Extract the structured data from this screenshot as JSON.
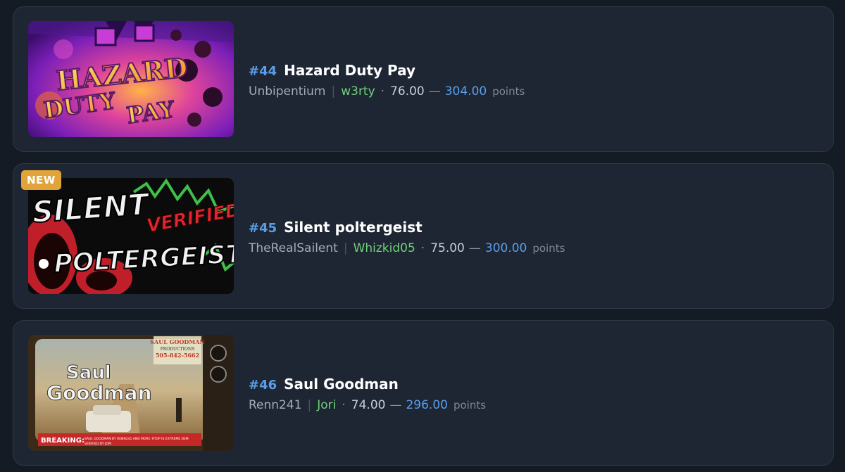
{
  "levels": [
    {
      "rank": "#44",
      "name": "Hazard Duty Pay",
      "creator": "Unbipentium",
      "separator": "|",
      "verifier": "w3rty",
      "points_min": "76.00",
      "points_max": "304.00",
      "points_label": "points",
      "thumbnail_text": [
        "HAZARD",
        "DUTY",
        "PAY"
      ]
    },
    {
      "rank": "#45",
      "name": "Silent poltergeist",
      "creator": "TheRealSailent",
      "separator": "|",
      "verifier": "Whizkid05",
      "points_min": "75.00",
      "points_max": "300.00",
      "points_label": "points",
      "badge": "NEW",
      "thumbnail_text": [
        "SILENT",
        "POLTERGEIST",
        "VERIFIED"
      ]
    },
    {
      "rank": "#46",
      "name": "Saul Goodman",
      "creator": "Renn241",
      "separator": "|",
      "verifier": "Jori",
      "points_min": "74.00",
      "points_max": "296.00",
      "points_label": "points",
      "thumbnail_text": [
        "Saul",
        "Goodman",
        "SAUL GOODMAN",
        "PRODUCTIONS",
        "505-842-5662",
        "BREAKING:",
        "SAUL GOODMAN BY RENN241 AND MORE #TOP IS EXTREME DEM",
        "VERIFIED BY JORI"
      ]
    }
  ],
  "colors": {
    "background": "#151b25",
    "card": "#1e2634",
    "rank": "#5b9ee8",
    "verifier": "#6fd17a",
    "points_max": "#5b9ee8",
    "badge": "#e2a33a"
  },
  "icons": {
    "separator_dot": "·",
    "range_dash": "—"
  }
}
